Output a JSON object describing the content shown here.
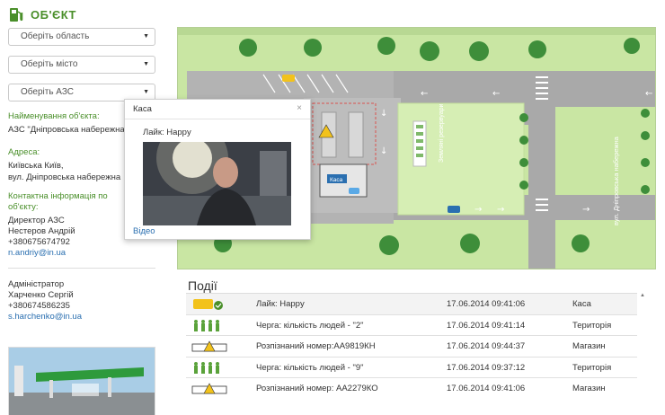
{
  "header": {
    "title": "ОБ'ЄКТ",
    "icon": "gas-pump-icon",
    "accent": "#4a8f2a"
  },
  "filters": [
    {
      "placeholder": "Оберіть область"
    },
    {
      "placeholder": "Оберіть місто"
    },
    {
      "placeholder": "Оберіть АЗС"
    }
  ],
  "object": {
    "name_label": "Найменування об'єкта:",
    "name_value": "АЗС \"Дніпровська набережна\"",
    "address_label": "Адреса:",
    "address_line1": "Київська Київ,",
    "address_line2": "вул. Дніпровська набережна",
    "contacts_label_1": "Контактна інформація по",
    "contacts_label_2": "об'єкту:",
    "director_role": "Директор АЗС",
    "director_name": "Нестеров Андрій",
    "director_phone": "+380675674792",
    "director_email": "n.andriy@in.ua",
    "admin_role": "Адміністратор",
    "admin_name": "Харченко Сергій",
    "admin_phone": "+380674586235",
    "admin_email": "s.harchenko@in.ua"
  },
  "map": {
    "reserve_label": "Земляні резервуари",
    "street_label": "вул. Дніпровська набережна",
    "cashier_marker": "Каса",
    "colors": {
      "grass": "#c9e6a3",
      "road": "#a9a9a9",
      "lot": "#b5b5b5",
      "accent": "#2a6fb0"
    }
  },
  "popup": {
    "title": "Каса",
    "close": "×",
    "text": "Лайк: Happy",
    "video_link": "Відео"
  },
  "events": {
    "title": "Події",
    "rows": [
      {
        "icon": "like-icon",
        "desc": "Лайк: Happy",
        "time": "17.06.2014 09:41:06",
        "place": "Каса"
      },
      {
        "icon": "queue-icon",
        "desc": "Черга: кількість людей - \"2\"",
        "time": "17.06.2014 09:41:14",
        "place": "Територія"
      },
      {
        "icon": "plate-icon",
        "desc": "Розпізнаний номер:АА9819КН",
        "time": "17.06.2014 09:44:37",
        "place": "Магазин"
      },
      {
        "icon": "queue-icon",
        "desc": "Черга: кількість людей - \"9\"",
        "time": "17.06.2014 09:37:12",
        "place": "Територія"
      },
      {
        "icon": "plate-icon",
        "desc": "Розпізнаний номер: АА2279КО",
        "time": "17.06.2014 09:41:06",
        "place": "Магазин"
      }
    ]
  }
}
